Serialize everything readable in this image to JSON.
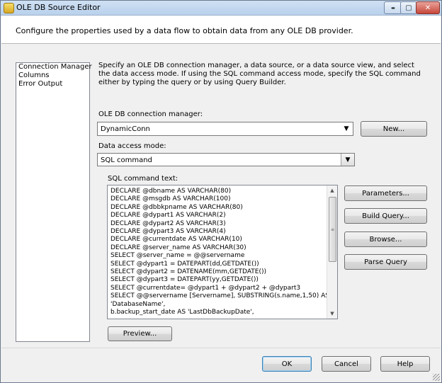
{
  "window": {
    "title": "OLE DB Source Editor",
    "min_label": "▬",
    "max_label": "▢",
    "close_label": "✕"
  },
  "header": {
    "text": "Configure the properties used by a data flow to obtain data from any OLE DB provider."
  },
  "nav": {
    "items": [
      {
        "label": "Connection Manager"
      },
      {
        "label": "Columns"
      },
      {
        "label": "Error Output"
      }
    ]
  },
  "main": {
    "description": "Specify an OLE DB connection manager, a data source, or a data source view, and select the data access mode. If using the SQL command access mode, specify the SQL command either by typing the query or by using Query Builder.",
    "connection_label": "OLE DB connection manager:",
    "connection_value": "DynamicConn",
    "new_button": "New...",
    "access_mode_label": "Data access mode:",
    "access_mode_value": "SQL command",
    "sql_label": "SQL command text:",
    "sql_lines": [
      "DECLARE @dbname AS VARCHAR(80)",
      "DECLARE @msgdb AS VARCHAR(100)",
      "DECLARE @dbbkpname AS VARCHAR(80)",
      "DECLARE @dypart1 AS VARCHAR(2)",
      "DECLARE @dypart2 AS VARCHAR(3)",
      "DECLARE @dypart3 AS VARCHAR(4)",
      "DECLARE @currentdate AS VARCHAR(10)",
      "DECLARE @server_name AS VARCHAR(30)",
      "SELECT @server_name = @@servername",
      "SELECT @dypart1 = DATEPART(dd,GETDATE())",
      "SELECT @dypart2 = DATENAME(mm,GETDATE())",
      "SELECT @dypart3 = DATEPART(yy,GETDATE())",
      "SELECT @currentdate= @dypart1 + @dypart2 + @dypart3",
      "SELECT @@servername [Servername], SUBSTRING(s.name,1,50) AS",
      "'DatabaseName',",
      "b.backup_start_date AS 'LastDbBackupDate',"
    ],
    "parameters_button": "Parameters...",
    "build_query_button": "Build Query...",
    "browse_button": "Browse...",
    "parse_query_button": "Parse Query",
    "preview_button": "Preview..."
  },
  "footer": {
    "ok": "OK",
    "cancel": "Cancel",
    "help": "Help"
  }
}
